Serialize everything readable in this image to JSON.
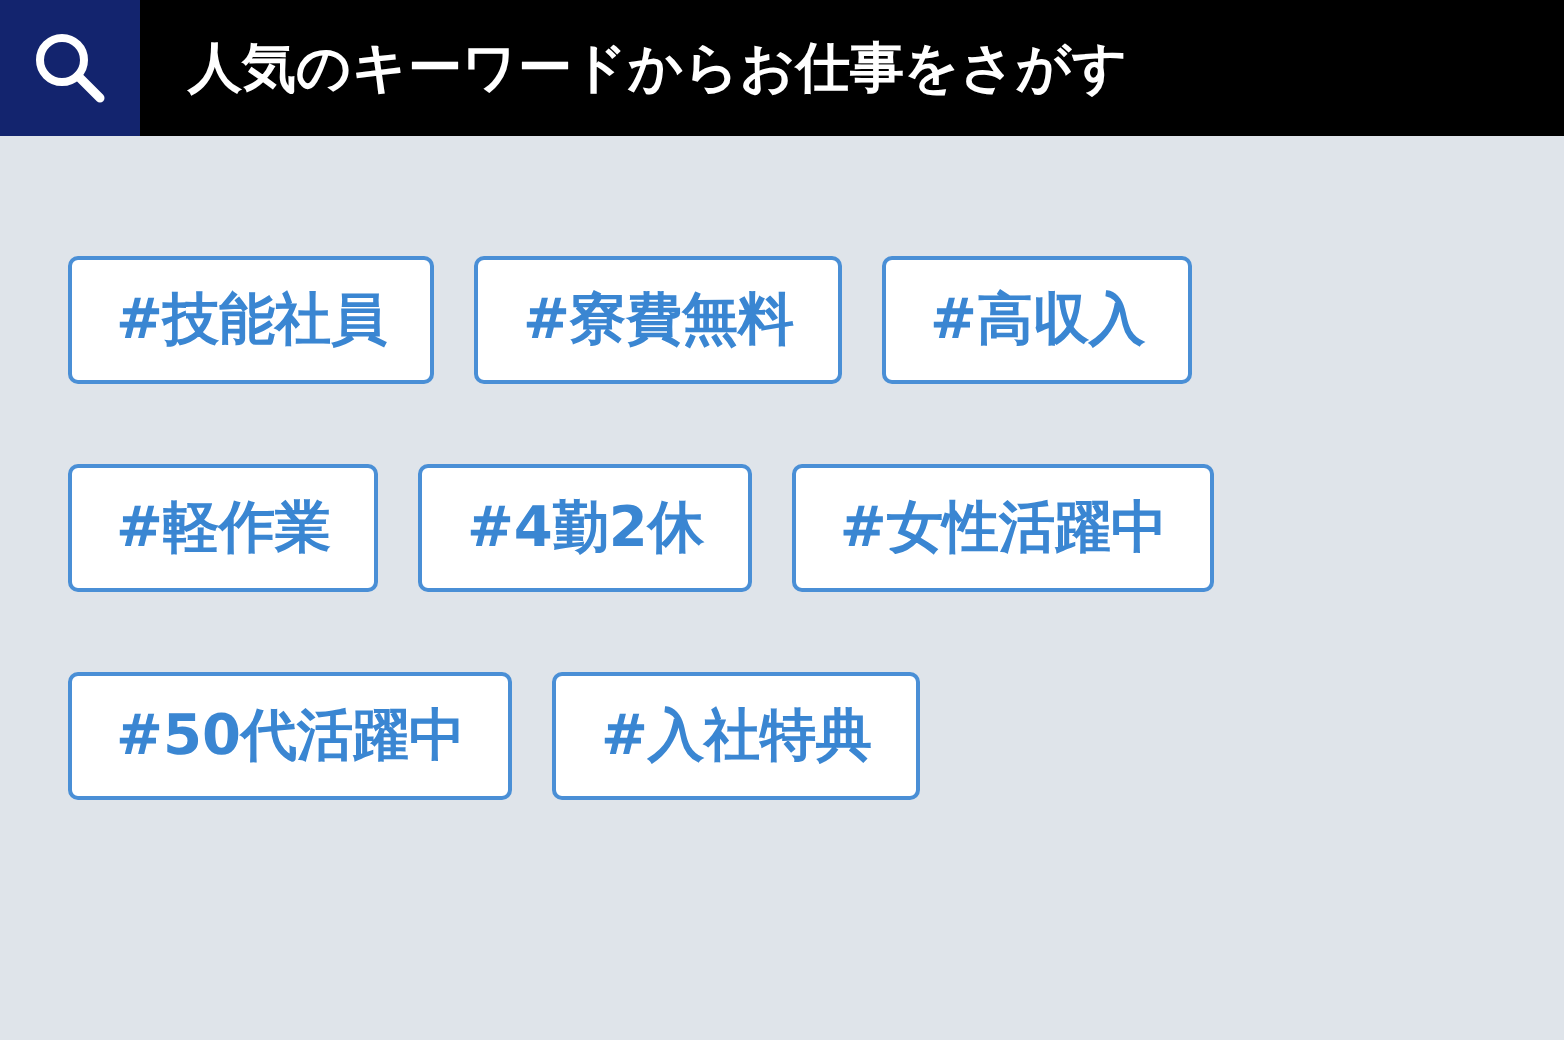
{
  "header": {
    "title": "人気のキーワードからお仕事をさがす"
  },
  "keyword_rows": [
    {
      "tags": [
        "#技能社員",
        "#寮費無料",
        "#高収入"
      ]
    },
    {
      "tags": [
        "#軽作業",
        "#4勤2休",
        "#女性活躍中"
      ]
    },
    {
      "tags": [
        "#50代活躍中",
        "#入社特典"
      ]
    }
  ]
}
